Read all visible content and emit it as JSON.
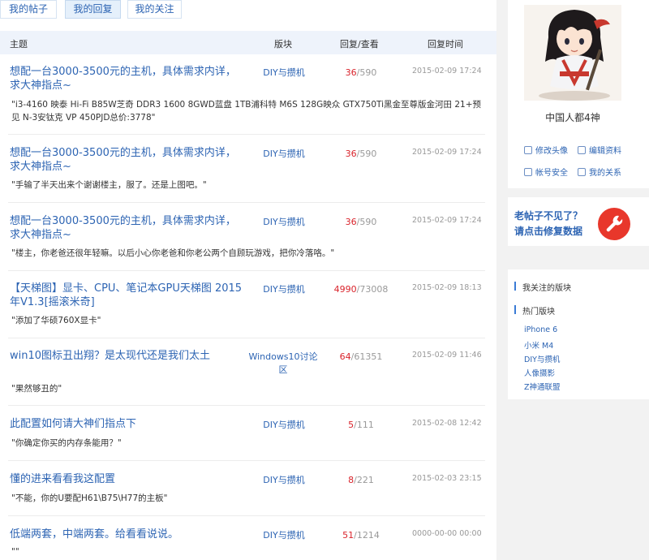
{
  "tabs": [
    "我的帖子",
    "我的回复",
    "我的关注"
  ],
  "table_header": {
    "topic": "主题",
    "board": "版块",
    "reply_view": "回复/查看",
    "reply_time": "回复时间"
  },
  "rows": [
    {
      "title": "想配一台3000-3500元的主机，具体需求内详，求大神指点~",
      "board": "DIY与攒机",
      "replies": "36",
      "views": "/590",
      "time": "2015-02-09 17:24",
      "quote": "\"i3-4160 映泰 Hi-Fi B85W芝奇 DDR3 1600 8GWD蓝盘 1TB浦科特 M6S 128G映众 GTX750Ti黑金至尊版金河田 21+预见 N-3安钛克 VP 450PJD总价:3778\""
    },
    {
      "title": "想配一台3000-3500元的主机，具体需求内详，求大神指点~",
      "board": "DIY与攒机",
      "replies": "36",
      "views": "/590",
      "time": "2015-02-09 17:24",
      "quote": "\"手输了半天出来个谢谢楼主，服了。还是上图吧。\""
    },
    {
      "title": "想配一台3000-3500元的主机，具体需求内详，求大神指点~",
      "board": "DIY与攒机",
      "replies": "36",
      "views": "/590",
      "time": "2015-02-09 17:24",
      "quote": "\"楼主，你老爸还很年轻嘛。以后小心你老爸和你老公两个自顾玩游戏，把你冷落咯。\""
    },
    {
      "title": "【天梯图】显卡、CPU、笔记本GPU天梯图 2015年V1.3[摇滚米奇]",
      "board": "DIY与攒机",
      "replies": "4990",
      "views": "/73008",
      "time": "2015-02-09 18:13",
      "quote": "\"添加了华硕760X显卡\""
    },
    {
      "title": "win10图标丑出翔？是太现代还是我们太土",
      "board": "Windows10讨论区",
      "replies": "64",
      "views": "/61351",
      "time": "2015-02-09 11:46",
      "quote": "\"果然够丑的\""
    },
    {
      "title": "此配置如何请大神们指点下",
      "board": "DIY与攒机",
      "replies": "5",
      "views": "/111",
      "time": "2015-02-08 12:42",
      "quote": "\"你确定你买的内存条能用？\""
    },
    {
      "title": "懂的进来看看我这配置",
      "board": "DIY与攒机",
      "replies": "8",
      "views": "/221",
      "time": "2015-02-03 23:15",
      "quote": "\"不能，你的U要配H61\\B75\\H77的主板\""
    },
    {
      "title": "低端两套，中端两套。给看看说说。",
      "board": "DIY与攒机",
      "replies": "51",
      "views": "/1214",
      "time": "0000-00-00 00:00",
      "quote": "\"\""
    }
  ],
  "profile": {
    "username": "中国人都4神",
    "links": [
      "修改头像",
      "编辑资料",
      "帐号安全",
      "我的关系"
    ]
  },
  "repair": {
    "line1": "老帖子不见了？",
    "line2": "请点击修复数据"
  },
  "boards_panel": {
    "followed_heading": "我关注的版块",
    "hot_heading": "热门版块",
    "hot_items": [
      "iPhone 6",
      "小米 M4",
      "DIY与攒机",
      "人像摄影",
      "Z神通联盟"
    ]
  },
  "colors": {
    "link": "#2d64b3",
    "reply_count": "#d9232b",
    "header_bg": "#eef3fb",
    "accent_red": "#e8372b"
  }
}
